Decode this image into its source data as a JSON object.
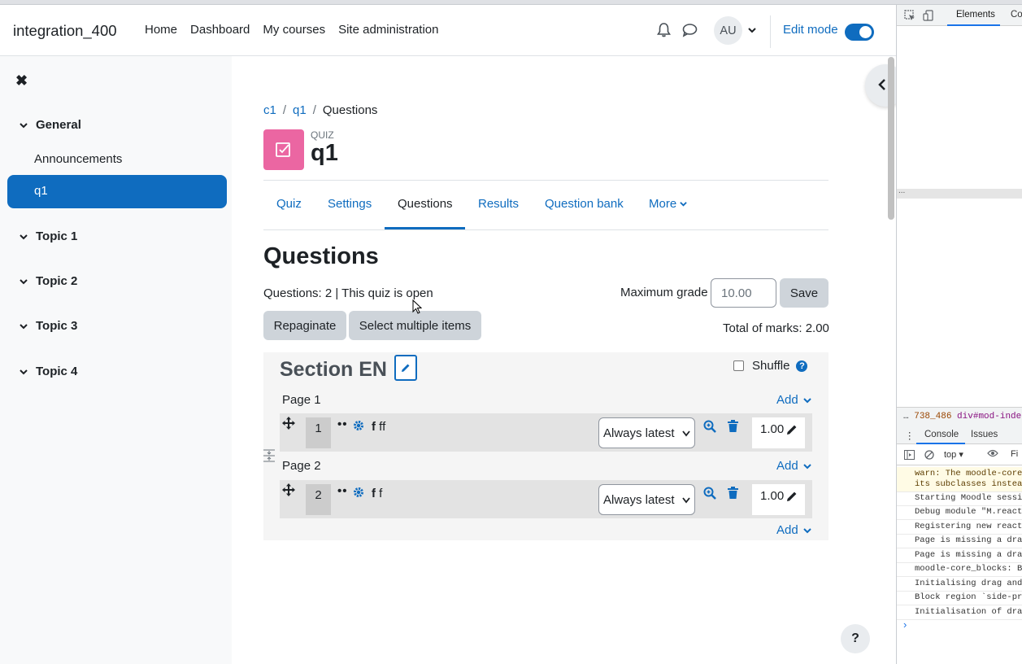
{
  "navbar": {
    "brand": "integration_400",
    "links": [
      "Home",
      "Dashboard",
      "My courses",
      "Site administration"
    ],
    "avatar_initials": "AU",
    "edit_mode_label": "Edit mode",
    "edit_mode_on": true
  },
  "drawer": {
    "sections": [
      "General",
      "Topic 1",
      "Topic 2",
      "Topic 3",
      "Topic 4"
    ],
    "general_items": [
      "Announcements",
      "q1"
    ],
    "active_item": "q1"
  },
  "breadcrumb": [
    "c1",
    "q1",
    "Questions"
  ],
  "activity": {
    "type_label": "QUIZ",
    "title": "q1"
  },
  "tabs": [
    "Quiz",
    "Settings",
    "Questions",
    "Results",
    "Question bank",
    "More"
  ],
  "active_tab": "Questions",
  "content": {
    "heading": "Questions",
    "status_line": "Questions: 2 | This quiz is open",
    "max_grade_label": "Maximum grade",
    "max_grade_value": "10.00",
    "save_label": "Save",
    "repaginate_label": "Repaginate",
    "select_multiple_label": "Select multiple items",
    "total_marks": "Total of marks: 2.00"
  },
  "section": {
    "heading": "Section EN",
    "shuffle_label": "Shuffle",
    "add_label": "Add",
    "pages": [
      {
        "label": "Page 1",
        "question": {
          "number": "1",
          "name_bold": "f",
          "name_rest": "ff",
          "version": "Always latest",
          "mark": "1.00"
        }
      },
      {
        "label": "Page 2",
        "question": {
          "number": "2",
          "name_bold": "f",
          "name_rest": "f",
          "version": "Always latest",
          "mark": "1.00"
        }
      }
    ]
  },
  "help_label": "?",
  "devtools": {
    "top_tabs": [
      "Elements",
      "Co"
    ],
    "crumb_id": "738_486",
    "crumb_node": "div#mod-inder",
    "bottom_tabs": [
      "Console",
      "Issues"
    ],
    "context": "top",
    "filter": "Fi",
    "logs": [
      "warn: The moodle-core-n",
      "its subclasses instead",
      "Starting Moodle session",
      "Debug module \"M.reactiv",
      "Registering new reactiv",
      "Page is missing a drawe",
      "Page is missing a drawe",
      "moodle-core_blocks: Blo",
      "Initialising drag and d",
      "Block region `side-pre",
      "Initialisation of drag"
    ]
  },
  "colors": {
    "primary": "#0f6cbf",
    "quiz_icon": "#eb66a2",
    "drawer_bg": "#f8f9fa"
  }
}
